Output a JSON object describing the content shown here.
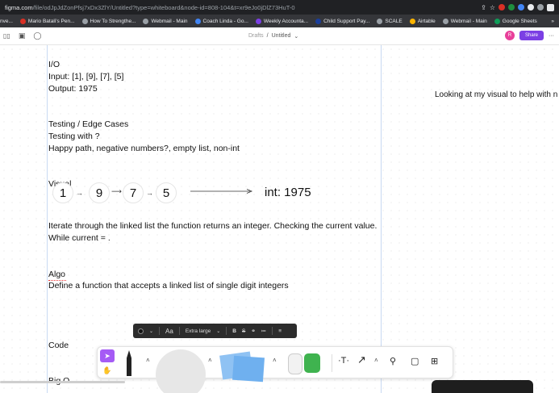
{
  "browser": {
    "url_host": "figma.com",
    "url_rest": "/file/odJpJdZonPfsj7xDx3ZlY/Untitled?type=whiteboard&node-id=808-104&t=xr9eJo0jDlZ73HuT-0",
    "bookmarks": [
      {
        "label": "nve...",
        "color": "#888888"
      },
      {
        "label": "Mario Batali's Pen...",
        "color": "#d93025"
      },
      {
        "label": "How To Strengthe...",
        "color": "#9aa0a6"
      },
      {
        "label": "Webmail - Main",
        "color": "#9aa0a6"
      },
      {
        "label": "Coach Linda - Go...",
        "color": "#4285f4"
      },
      {
        "label": "Weekly Accounta...",
        "color": "#7b3fe4"
      },
      {
        "label": "Child Support Pay...",
        "color": "#1a3e9c"
      },
      {
        "label": "SCALE",
        "color": "#9aa0a6"
      },
      {
        "label": "Airtable",
        "color": "#fcb400"
      },
      {
        "label": "Webmail - Main",
        "color": "#9aa0a6"
      },
      {
        "label": "Google Sheets",
        "color": "#0f9d58"
      }
    ],
    "bookmarks_more": "»"
  },
  "figma": {
    "breadcrumb_drafts": "Drafts",
    "breadcrumb_sep": "/",
    "file_name": "Untitled",
    "avatar_initial": "R",
    "share_label": "Share",
    "more_label": "···"
  },
  "canvas": {
    "heading_io": "I/O",
    "input_line": "Input: [1], [9], [7], [5]",
    "output_line": "Output: 1975",
    "testing_heading": "Testing / Edge Cases",
    "testing_with": "Testing with ?",
    "testing_cases": "Happy path, negative numbers?, empty list, non-int",
    "visual_label": "Visual",
    "nodes": [
      "1",
      "9",
      "7",
      "5"
    ],
    "result": "int: 1975",
    "iterate_text": "Iterate through the linked list the function returns an integer.  Checking the current value.",
    "while_text": "While current = .",
    "algo_heading": "Algo",
    "algo_text": "Define a function that accepts a linked list of single digit integers",
    "code_heading": "Code",
    "bigo_heading": "Big O",
    "side_note": "Looking at my visual to help with n"
  },
  "format_toolbar": {
    "font_label": "Aa",
    "size_label": "Extra large",
    "bold": "B",
    "strike": "S"
  },
  "colors": {
    "accent_purple": "#7b3fe4",
    "select_tool": "#a55bf5",
    "avatar": "#e83f9a"
  }
}
